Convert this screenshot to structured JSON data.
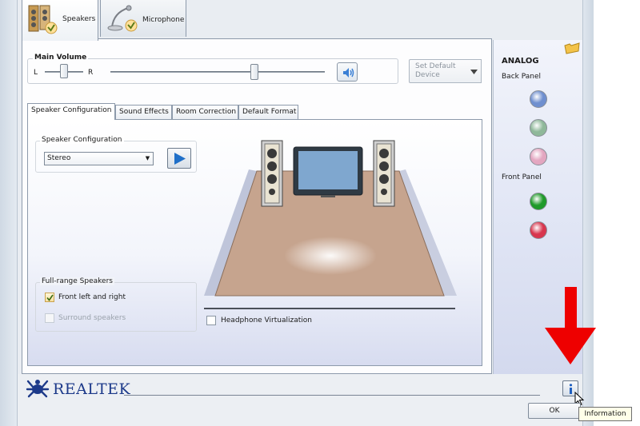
{
  "device_tabs": [
    {
      "label": "Speakers",
      "selected": true
    },
    {
      "label": "Microphone",
      "selected": false
    }
  ],
  "main_volume": {
    "label": "Main Volume",
    "left": "L",
    "right": "R",
    "balance": 0.5,
    "level": 0.67,
    "set_default_label": "Set Default Device"
  },
  "inner_tabs": [
    {
      "label": "Speaker Configuration",
      "selected": true
    },
    {
      "label": "Sound Effects",
      "selected": false
    },
    {
      "label": "Room Correction",
      "selected": false
    },
    {
      "label": "Default Format",
      "selected": false
    }
  ],
  "speaker_config": {
    "group_label": "Speaker Configuration",
    "selected": "Stereo"
  },
  "fullrange": {
    "group_label": "Full-range Speakers",
    "front_label": "Front left and right",
    "front_checked": true,
    "surround_label": "Surround speakers",
    "surround_checked": false
  },
  "headphone_label": "Headphone Virtualization",
  "analog": {
    "title": "ANALOG",
    "back_panel": "Back Panel",
    "front_panel": "Front Panel",
    "back_jacks": [
      "#6f8fcf",
      "#8fb89a",
      "#e3a6c0"
    ],
    "front_jacks": [
      "#1f9a2a",
      "#d8364e"
    ]
  },
  "brand": "REALTEK",
  "buttons": {
    "ok": "OK"
  },
  "tooltip": "Information"
}
